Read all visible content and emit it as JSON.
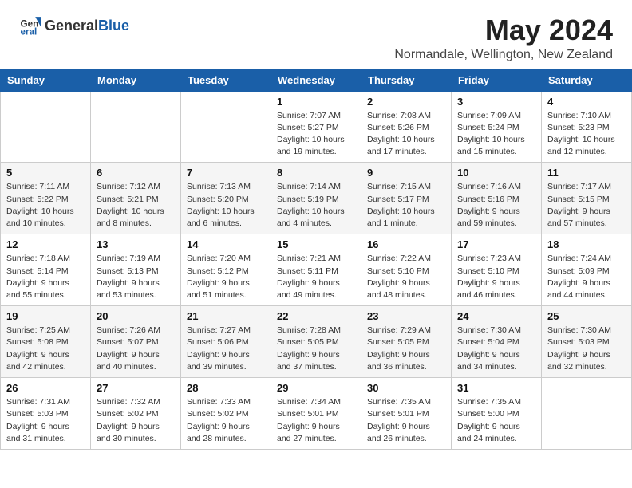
{
  "header": {
    "logo_general": "General",
    "logo_blue": "Blue",
    "title": "May 2024",
    "subtitle": "Normandale, Wellington, New Zealand"
  },
  "days_of_week": [
    "Sunday",
    "Monday",
    "Tuesday",
    "Wednesday",
    "Thursday",
    "Friday",
    "Saturday"
  ],
  "weeks": [
    [
      {
        "num": "",
        "sunrise": "",
        "sunset": "",
        "daylight": ""
      },
      {
        "num": "",
        "sunrise": "",
        "sunset": "",
        "daylight": ""
      },
      {
        "num": "",
        "sunrise": "",
        "sunset": "",
        "daylight": ""
      },
      {
        "num": "1",
        "sunrise": "Sunrise: 7:07 AM",
        "sunset": "Sunset: 5:27 PM",
        "daylight": "Daylight: 10 hours and 19 minutes."
      },
      {
        "num": "2",
        "sunrise": "Sunrise: 7:08 AM",
        "sunset": "Sunset: 5:26 PM",
        "daylight": "Daylight: 10 hours and 17 minutes."
      },
      {
        "num": "3",
        "sunrise": "Sunrise: 7:09 AM",
        "sunset": "Sunset: 5:24 PM",
        "daylight": "Daylight: 10 hours and 15 minutes."
      },
      {
        "num": "4",
        "sunrise": "Sunrise: 7:10 AM",
        "sunset": "Sunset: 5:23 PM",
        "daylight": "Daylight: 10 hours and 12 minutes."
      }
    ],
    [
      {
        "num": "5",
        "sunrise": "Sunrise: 7:11 AM",
        "sunset": "Sunset: 5:22 PM",
        "daylight": "Daylight: 10 hours and 10 minutes."
      },
      {
        "num": "6",
        "sunrise": "Sunrise: 7:12 AM",
        "sunset": "Sunset: 5:21 PM",
        "daylight": "Daylight: 10 hours and 8 minutes."
      },
      {
        "num": "7",
        "sunrise": "Sunrise: 7:13 AM",
        "sunset": "Sunset: 5:20 PM",
        "daylight": "Daylight: 10 hours and 6 minutes."
      },
      {
        "num": "8",
        "sunrise": "Sunrise: 7:14 AM",
        "sunset": "Sunset: 5:19 PM",
        "daylight": "Daylight: 10 hours and 4 minutes."
      },
      {
        "num": "9",
        "sunrise": "Sunrise: 7:15 AM",
        "sunset": "Sunset: 5:17 PM",
        "daylight": "Daylight: 10 hours and 1 minute."
      },
      {
        "num": "10",
        "sunrise": "Sunrise: 7:16 AM",
        "sunset": "Sunset: 5:16 PM",
        "daylight": "Daylight: 9 hours and 59 minutes."
      },
      {
        "num": "11",
        "sunrise": "Sunrise: 7:17 AM",
        "sunset": "Sunset: 5:15 PM",
        "daylight": "Daylight: 9 hours and 57 minutes."
      }
    ],
    [
      {
        "num": "12",
        "sunrise": "Sunrise: 7:18 AM",
        "sunset": "Sunset: 5:14 PM",
        "daylight": "Daylight: 9 hours and 55 minutes."
      },
      {
        "num": "13",
        "sunrise": "Sunrise: 7:19 AM",
        "sunset": "Sunset: 5:13 PM",
        "daylight": "Daylight: 9 hours and 53 minutes."
      },
      {
        "num": "14",
        "sunrise": "Sunrise: 7:20 AM",
        "sunset": "Sunset: 5:12 PM",
        "daylight": "Daylight: 9 hours and 51 minutes."
      },
      {
        "num": "15",
        "sunrise": "Sunrise: 7:21 AM",
        "sunset": "Sunset: 5:11 PM",
        "daylight": "Daylight: 9 hours and 49 minutes."
      },
      {
        "num": "16",
        "sunrise": "Sunrise: 7:22 AM",
        "sunset": "Sunset: 5:10 PM",
        "daylight": "Daylight: 9 hours and 48 minutes."
      },
      {
        "num": "17",
        "sunrise": "Sunrise: 7:23 AM",
        "sunset": "Sunset: 5:10 PM",
        "daylight": "Daylight: 9 hours and 46 minutes."
      },
      {
        "num": "18",
        "sunrise": "Sunrise: 7:24 AM",
        "sunset": "Sunset: 5:09 PM",
        "daylight": "Daylight: 9 hours and 44 minutes."
      }
    ],
    [
      {
        "num": "19",
        "sunrise": "Sunrise: 7:25 AM",
        "sunset": "Sunset: 5:08 PM",
        "daylight": "Daylight: 9 hours and 42 minutes."
      },
      {
        "num": "20",
        "sunrise": "Sunrise: 7:26 AM",
        "sunset": "Sunset: 5:07 PM",
        "daylight": "Daylight: 9 hours and 40 minutes."
      },
      {
        "num": "21",
        "sunrise": "Sunrise: 7:27 AM",
        "sunset": "Sunset: 5:06 PM",
        "daylight": "Daylight: 9 hours and 39 minutes."
      },
      {
        "num": "22",
        "sunrise": "Sunrise: 7:28 AM",
        "sunset": "Sunset: 5:05 PM",
        "daylight": "Daylight: 9 hours and 37 minutes."
      },
      {
        "num": "23",
        "sunrise": "Sunrise: 7:29 AM",
        "sunset": "Sunset: 5:05 PM",
        "daylight": "Daylight: 9 hours and 36 minutes."
      },
      {
        "num": "24",
        "sunrise": "Sunrise: 7:30 AM",
        "sunset": "Sunset: 5:04 PM",
        "daylight": "Daylight: 9 hours and 34 minutes."
      },
      {
        "num": "25",
        "sunrise": "Sunrise: 7:30 AM",
        "sunset": "Sunset: 5:03 PM",
        "daylight": "Daylight: 9 hours and 32 minutes."
      }
    ],
    [
      {
        "num": "26",
        "sunrise": "Sunrise: 7:31 AM",
        "sunset": "Sunset: 5:03 PM",
        "daylight": "Daylight: 9 hours and 31 minutes."
      },
      {
        "num": "27",
        "sunrise": "Sunrise: 7:32 AM",
        "sunset": "Sunset: 5:02 PM",
        "daylight": "Daylight: 9 hours and 30 minutes."
      },
      {
        "num": "28",
        "sunrise": "Sunrise: 7:33 AM",
        "sunset": "Sunset: 5:02 PM",
        "daylight": "Daylight: 9 hours and 28 minutes."
      },
      {
        "num": "29",
        "sunrise": "Sunrise: 7:34 AM",
        "sunset": "Sunset: 5:01 PM",
        "daylight": "Daylight: 9 hours and 27 minutes."
      },
      {
        "num": "30",
        "sunrise": "Sunrise: 7:35 AM",
        "sunset": "Sunset: 5:01 PM",
        "daylight": "Daylight: 9 hours and 26 minutes."
      },
      {
        "num": "31",
        "sunrise": "Sunrise: 7:35 AM",
        "sunset": "Sunset: 5:00 PM",
        "daylight": "Daylight: 9 hours and 24 minutes."
      },
      {
        "num": "",
        "sunrise": "",
        "sunset": "",
        "daylight": ""
      }
    ]
  ]
}
